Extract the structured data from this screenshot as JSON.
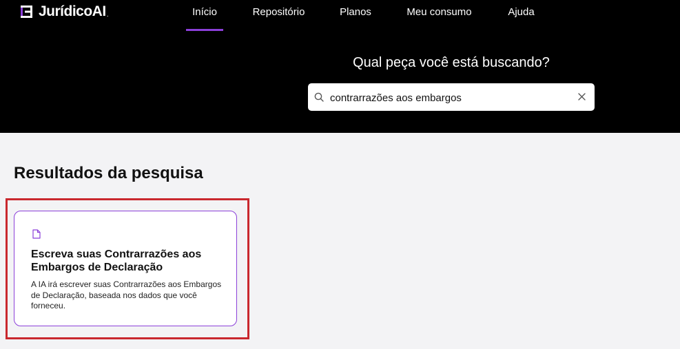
{
  "brand": {
    "name": "JurídicoAI",
    "dot": "."
  },
  "nav": {
    "items": [
      {
        "label": "Início",
        "active": true
      },
      {
        "label": "Repositório",
        "active": false
      },
      {
        "label": "Planos",
        "active": false
      },
      {
        "label": "Meu consumo",
        "active": false
      },
      {
        "label": "Ajuda",
        "active": false
      }
    ]
  },
  "search": {
    "heading": "Qual peça você está buscando?",
    "value": "contrarrazões aos embargos",
    "icon": "search-icon",
    "clear_icon": "close-icon"
  },
  "results": {
    "title": "Resultados da pesquisa",
    "cards": [
      {
        "icon": "document-icon",
        "title": "Escreva suas Contrarrazões aos Embargos de Declaração",
        "description": "A IA irá escrever suas Contrarrazões aos Embargos de Declaração, baseada nos dados que você forneceu."
      }
    ]
  },
  "colors": {
    "accent": "#8b3fd9",
    "highlight": "#c9282e",
    "header_bg": "#000000",
    "page_bg": "#f3f3f5"
  }
}
